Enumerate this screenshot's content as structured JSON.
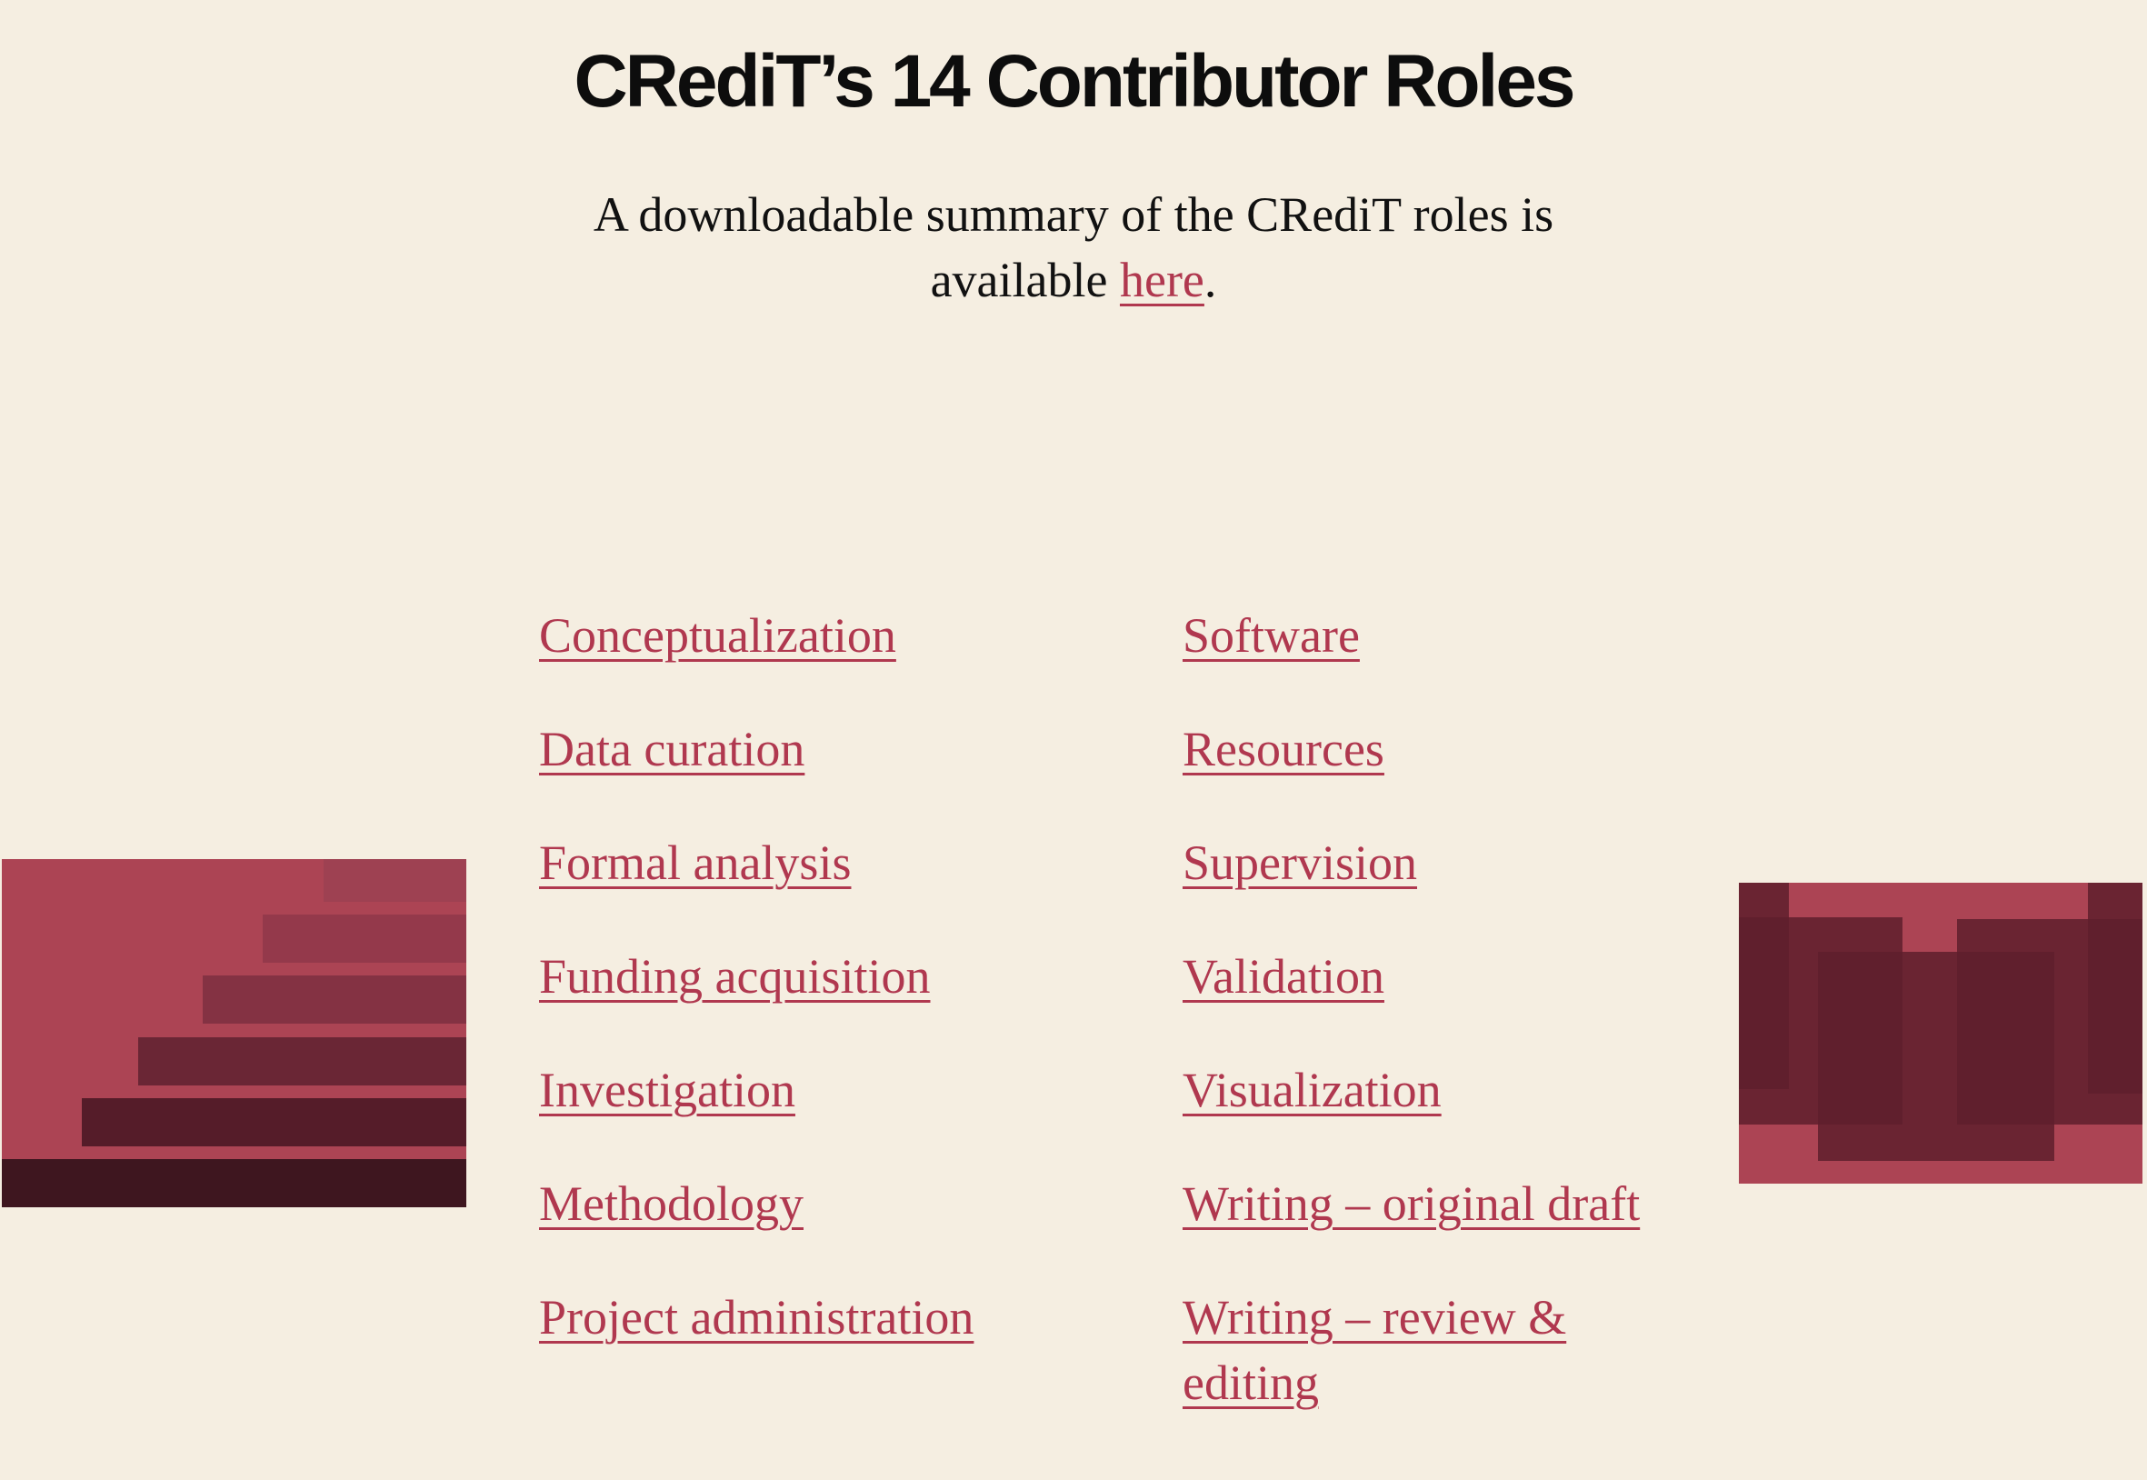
{
  "header": {
    "title": "CRediT’s 14 Contributor Roles"
  },
  "intro": {
    "text_before": "A downloadable summary of the CRediT roles is available ",
    "link_label": "here",
    "text_after": "."
  },
  "roles": {
    "column_1": [
      "Conceptualization",
      "Data curation",
      "Formal analysis",
      "Funding acquisition",
      "Investigation",
      "Methodology",
      "Project administration"
    ],
    "column_2": [
      "Software",
      "Resources",
      "Supervision",
      "Validation",
      "Visualization",
      "Writing – original draft",
      "Writing – review & editing"
    ]
  },
  "illustrations": {
    "left": "staircase-illustration",
    "right": "overlapping-blocks-illustration"
  },
  "colors": {
    "background": "#f5eee1",
    "link": "#b0384f",
    "accent_light": "#ac4454",
    "accent_dark": "#3e161f"
  }
}
